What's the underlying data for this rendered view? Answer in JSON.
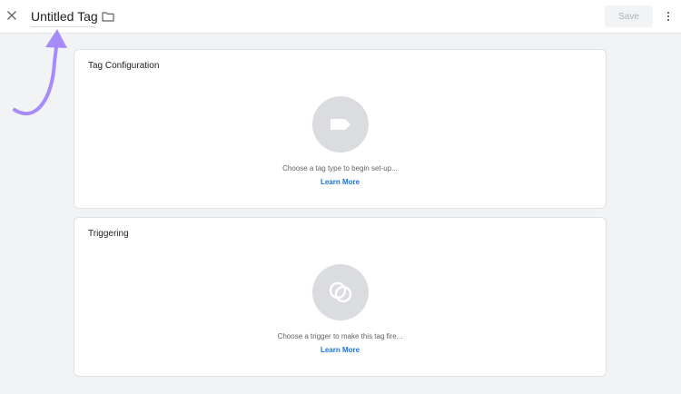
{
  "header": {
    "title": "Untitled Tag",
    "save_label": "Save",
    "close_icon": "close-icon",
    "folder_icon": "folder-icon",
    "more_icon": "more-vert-icon"
  },
  "annotation": {
    "arrow_icon": "curved-arrow-icon",
    "color": "#a78bfa"
  },
  "cards": {
    "config": {
      "title": "Tag Configuration",
      "icon": "tag-icon",
      "hint": "Choose a tag type to begin set-up...",
      "link": "Learn More"
    },
    "trigger": {
      "title": "Triggering",
      "icon": "trigger-icon",
      "hint": "Choose a trigger to make this tag fire...",
      "link": "Learn More"
    }
  },
  "colors": {
    "background": "#f1f3f4",
    "card": "#ffffff",
    "link": "#1a73e8",
    "icon_circle": "#dadce0"
  }
}
